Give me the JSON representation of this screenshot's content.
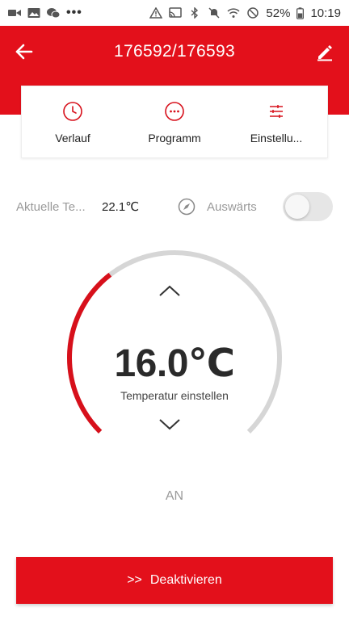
{
  "status_bar": {
    "battery_percent": "52%",
    "time": "10:19",
    "more": "•••"
  },
  "header": {
    "title": "176592/176593"
  },
  "tabs": [
    {
      "label": "Verlauf",
      "icon": "clock-icon"
    },
    {
      "label": "Programm",
      "icon": "ellipsis-circle-icon"
    },
    {
      "label": "Einstellu...",
      "icon": "sliders-icon"
    }
  ],
  "info": {
    "current_temp_label": "Aktuelle Te...",
    "current_temp_value": "22.1℃",
    "away_label": "Auswärts",
    "away_enabled": false
  },
  "dial": {
    "set_temperature": "16.0℃",
    "set_temperature_label": "Temperatur einstellen",
    "fill_fraction": 0.36,
    "colors": {
      "active": "#d7101b",
      "track": "#d6d6d6"
    }
  },
  "mode_state": "AN",
  "action": {
    "prefix": ">>",
    "label": "Deaktivieren"
  },
  "colors": {
    "brand": "#e3101b",
    "muted_text": "#9a9a9a"
  }
}
